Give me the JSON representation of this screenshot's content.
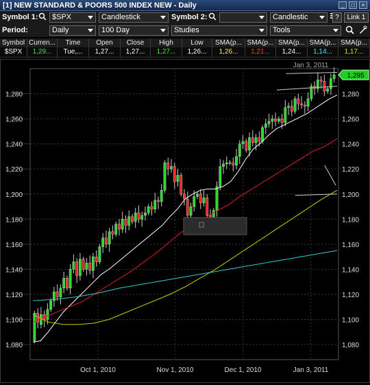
{
  "window": {
    "title": "[1] NEW STANDARD & POORS 500 INDEX NEW - Daily"
  },
  "toolbar": {
    "symbol1_label": "Symbol 1:",
    "symbol1_value": "$SPX",
    "chart_type": "Candlestick",
    "symbol2_label": "Symbol 2:",
    "symbol2_value": "",
    "chart_type2": "Candlestic",
    "help_label": "?",
    "link_label": "Link 1",
    "period_label": "Period:",
    "period_value": "Daily",
    "range_value": "100 Day",
    "studies_label": "Studies",
    "tools_label": "Tools"
  },
  "quote": {
    "headers": [
      "Symbol",
      "Curren...",
      "Time",
      "Open",
      "Close",
      "High",
      "Low",
      "SMA(p...",
      "SMA(p...",
      "SMA(p...",
      "SMA(p...",
      "SMA(p..."
    ],
    "values": [
      "$SPX",
      "1,29...",
      "Tue,...",
      "1,27...",
      "1,27...",
      "1,27...",
      "1,26...",
      "1,26...",
      "1,21...",
      "1,24...",
      "1,14...",
      "1,17..."
    ],
    "colors": [
      "#ffffff",
      "#33ee33",
      "#ffffff",
      "#ffffff",
      "#ffffff",
      "#33ee33",
      "#ffffff",
      "#ffff00",
      "#ff3333",
      "#ffffff",
      "#33eeee",
      "#dddd00"
    ]
  },
  "chart_data": {
    "type": "candlestick",
    "symbol": "$SPX",
    "ylim": [
      1068,
      1300
    ],
    "y_ticks": [
      "1,080",
      "1,100",
      "1,120",
      "1,140",
      "1,160",
      "1,180",
      "1,200",
      "1,220",
      "1,240",
      "1,260",
      "1,280"
    ],
    "x_ticks": [
      "Oct 1, 2010",
      "Nov 1, 2010",
      "Dec 1, 2010",
      "Jan 3, 2011"
    ],
    "top_date_label": "Jan 3, 2011",
    "current_price_label": "1,295",
    "candles_approx": [
      [
        1083,
        1105
      ],
      [
        1105,
        1098
      ],
      [
        1096,
        1104
      ],
      [
        1104,
        1100
      ],
      [
        1100,
        1108
      ],
      [
        1108,
        1115
      ],
      [
        1115,
        1122
      ],
      [
        1122,
        1118
      ],
      [
        1118,
        1125
      ],
      [
        1125,
        1133
      ],
      [
        1133,
        1125
      ],
      [
        1125,
        1140
      ],
      [
        1140,
        1146
      ],
      [
        1146,
        1135
      ],
      [
        1135,
        1148
      ],
      [
        1148,
        1140
      ],
      [
        1140,
        1145
      ],
      [
        1145,
        1139
      ],
      [
        1139,
        1150
      ],
      [
        1150,
        1146
      ],
      [
        1146,
        1158
      ],
      [
        1158,
        1165
      ],
      [
        1165,
        1160
      ],
      [
        1160,
        1170
      ],
      [
        1170,
        1168
      ],
      [
        1168,
        1176
      ],
      [
        1176,
        1172
      ],
      [
        1172,
        1180
      ],
      [
        1180,
        1175
      ],
      [
        1175,
        1182
      ],
      [
        1182,
        1178
      ],
      [
        1178,
        1185
      ],
      [
        1185,
        1180
      ],
      [
        1180,
        1183
      ],
      [
        1183,
        1185
      ],
      [
        1185,
        1190
      ],
      [
        1190,
        1188
      ],
      [
        1188,
        1195
      ],
      [
        1195,
        1194
      ],
      [
        1194,
        1203
      ],
      [
        1203,
        1225
      ],
      [
        1225,
        1220
      ],
      [
        1220,
        1222
      ],
      [
        1222,
        1210
      ],
      [
        1210,
        1215
      ],
      [
        1215,
        1200
      ],
      [
        1200,
        1196
      ],
      [
        1196,
        1183
      ],
      [
        1183,
        1190
      ],
      [
        1190,
        1198
      ],
      [
        1198,
        1200
      ],
      [
        1200,
        1193
      ],
      [
        1193,
        1197
      ],
      [
        1197,
        1183
      ],
      [
        1183,
        1180
      ],
      [
        1180,
        1187
      ],
      [
        1187,
        1206
      ],
      [
        1206,
        1222
      ],
      [
        1222,
        1224
      ],
      [
        1224,
        1225
      ],
      [
        1225,
        1225
      ],
      [
        1225,
        1223
      ],
      [
        1223,
        1230
      ],
      [
        1230,
        1240
      ],
      [
        1240,
        1242
      ],
      [
        1242,
        1235
      ],
      [
        1235,
        1245
      ],
      [
        1245,
        1241
      ],
      [
        1241,
        1245
      ],
      [
        1245,
        1242
      ],
      [
        1242,
        1253
      ],
      [
        1253,
        1256
      ],
      [
        1256,
        1258
      ],
      [
        1258,
        1260
      ],
      [
        1260,
        1258
      ],
      [
        1258,
        1260
      ],
      [
        1260,
        1257
      ],
      [
        1257,
        1269
      ],
      [
        1269,
        1270
      ],
      [
        1270,
        1266
      ],
      [
        1266,
        1276
      ],
      [
        1276,
        1272
      ],
      [
        1272,
        1271
      ],
      [
        1271,
        1270
      ],
      [
        1270,
        1276
      ],
      [
        1276,
        1286
      ],
      [
        1286,
        1284
      ],
      [
        1284,
        1291
      ],
      [
        1291,
        1290
      ],
      [
        1290,
        1282
      ],
      [
        1282,
        1284
      ],
      [
        1284,
        1292
      ],
      [
        1292,
        1295
      ]
    ],
    "series": [
      {
        "color": "#ffffff",
        "values": [
          1082,
          1083,
          1090,
          1098,
          1106,
          1112,
          1118,
          1124,
          1130,
          1136,
          1140,
          1145,
          1150,
          1155,
          1160,
          1165,
          1170,
          1175,
          1182,
          1188,
          1196,
          1200,
          1203,
          1204,
          1204,
          1206,
          1210,
          1218,
          1228,
          1236,
          1241,
          1247,
          1252,
          1255,
          1258,
          1261,
          1264,
          1268,
          1272,
          1276,
          1279
        ]
      },
      {
        "color": "#dd2222",
        "values": [
          1098,
          1102,
          1106,
          1110,
          1114,
          1120,
          1126,
          1132,
          1138,
          1145,
          1152,
          1160,
          1168,
          1175,
          1180,
          1186,
          1191,
          1198,
          1204,
          1210,
          1216,
          1222,
          1228,
          1234,
          1238,
          1244
        ]
      },
      {
        "color": "#cccc00",
        "values": [
          1104,
          1098,
          1096,
          1096,
          1097,
          1100,
          1105,
          1110,
          1115,
          1120,
          1126,
          1133,
          1140,
          1148,
          1156,
          1164,
          1172,
          1180,
          1188,
          1196,
          1203
        ]
      },
      {
        "color": "#33cccc",
        "values": [
          1115,
          1116,
          1118,
          1121,
          1125,
          1128,
          1131,
          1134,
          1137,
          1140,
          1143,
          1146,
          1149,
          1152,
          1155
        ]
      }
    ]
  }
}
